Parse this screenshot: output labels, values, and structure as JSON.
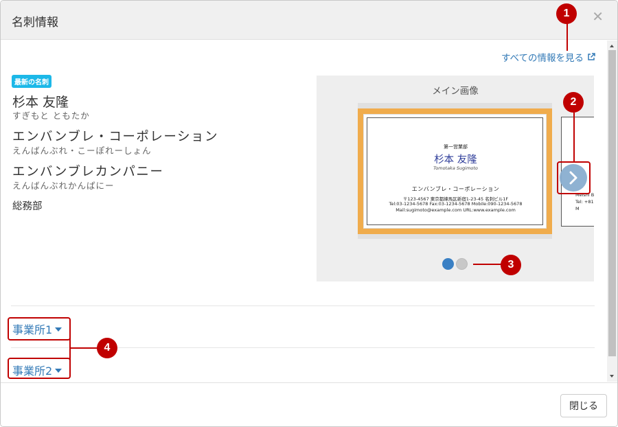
{
  "dialog": {
    "title": "名刺情報",
    "close_icon": "close-icon"
  },
  "links": {
    "all_info": "すべての情報を見る"
  },
  "badge": "最新の名刺",
  "person": {
    "name": "杉本 友隆",
    "name_kana": "すぎもと ともたか",
    "company1": "エンバンブレ・コーポレーション",
    "company1_kana": "えんばんぶれ・こーぽれーしょん",
    "company2": "エンバンブレカンパニー",
    "company2_kana": "えんばんぶれかんぱにー",
    "department": "総務部"
  },
  "gallery": {
    "label": "メイン画像",
    "card": {
      "dept": "第一営業部",
      "name": "杉本 友隆",
      "romaji": "Tomotaka Sugimoto",
      "company": "エンバンブレ・コーポレーション",
      "line1": "〒123-4567 東京都練馬区新宿1-23-45 名刺ビル1F",
      "line2": "Tel:03-1234-5678 Fax:03-1234-5678 Mobile:090-1234-5678",
      "line3": "Mail:sugimoto@example.com URL:www.example.com"
    },
    "next_card": {
      "line1": "Meishi B",
      "line2": "Tel: +81",
      "line3": "M"
    },
    "slide_count": 2,
    "active_slide": 1
  },
  "sections": [
    {
      "label": "事業所1"
    },
    {
      "label": "事業所2"
    }
  ],
  "footer": {
    "close_label": "閉じる"
  },
  "callouts": [
    "1",
    "2",
    "3",
    "4"
  ],
  "colors": {
    "link": "#337ab7",
    "badge": "#1cb8e8",
    "card_frame": "#f0ac4c",
    "callout": "#c00000",
    "dot_active": "#3a80c4"
  }
}
